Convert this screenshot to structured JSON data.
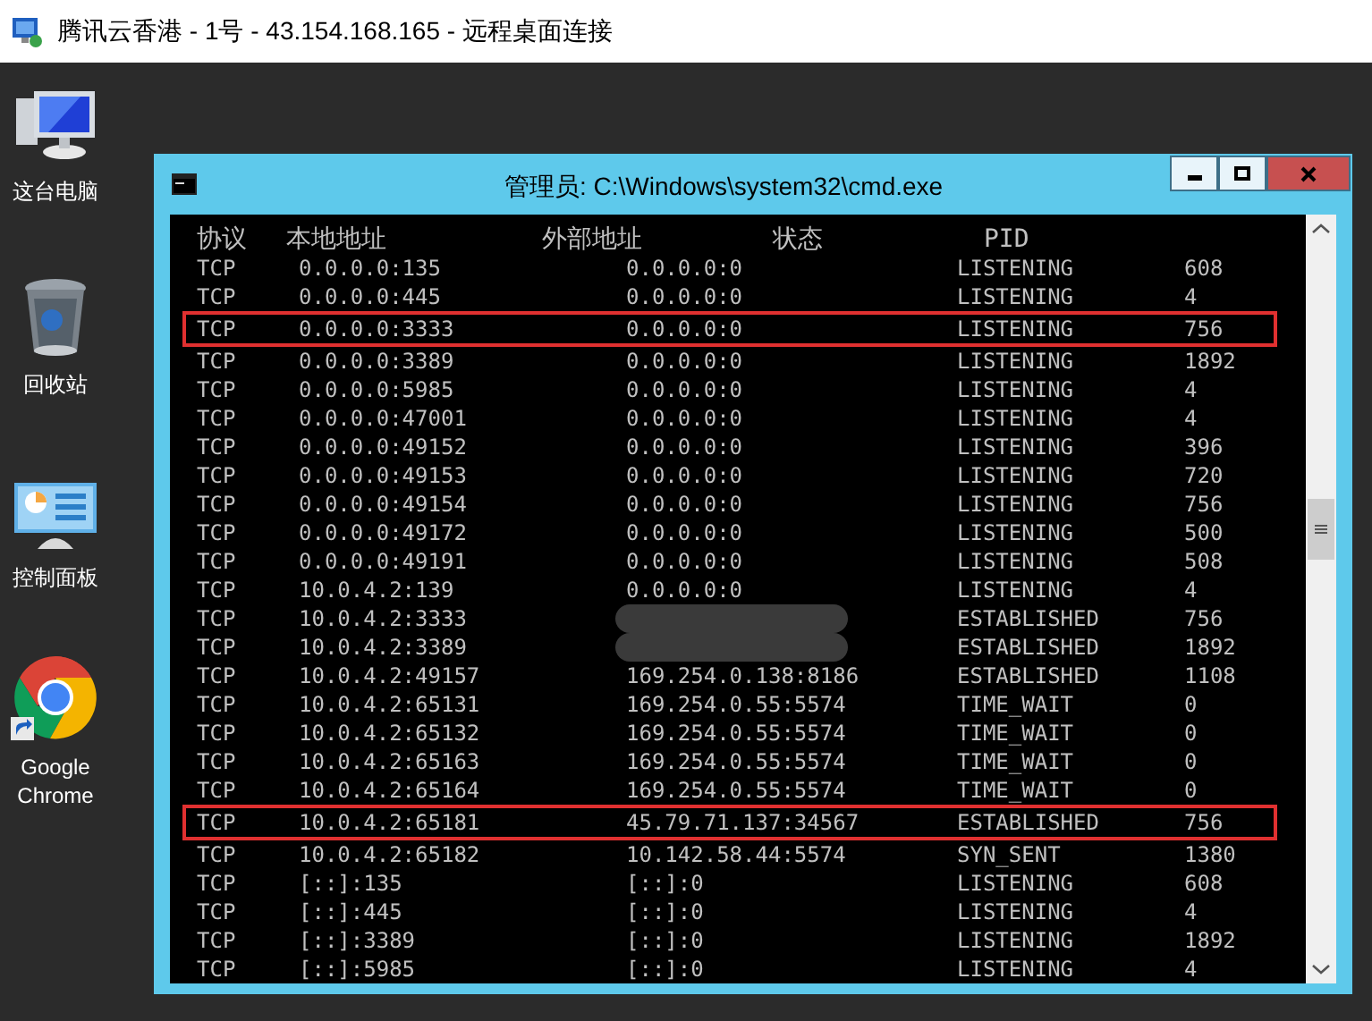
{
  "window": {
    "title": "腾讯云香港 - 1号 - 43.154.168.165 - 远程桌面连接"
  },
  "desktop_icons": [
    {
      "kind": "computer",
      "label": "这台电脑"
    },
    {
      "kind": "recycle",
      "label": "回收站"
    },
    {
      "kind": "control",
      "label": "控制面板"
    },
    {
      "kind": "browser",
      "label": "Google Chrome"
    }
  ],
  "console": {
    "title": "管理员: C:\\Windows\\system32\\cmd.exe",
    "headers": [
      "协议",
      "本地地址",
      "外部地址",
      "状态",
      "PID"
    ],
    "rows": [
      {
        "proto": "TCP",
        "local": "0.0.0.0:135",
        "foreign": "0.0.0.0:0",
        "state": "LISTENING",
        "pid": "608",
        "highlighted": false,
        "blurred": false
      },
      {
        "proto": "TCP",
        "local": "0.0.0.0:445",
        "foreign": "0.0.0.0:0",
        "state": "LISTENING",
        "pid": "4",
        "highlighted": false,
        "blurred": false
      },
      {
        "proto": "TCP",
        "local": "0.0.0.0:3333",
        "foreign": "0.0.0.0:0",
        "state": "LISTENING",
        "pid": "756",
        "highlighted": true,
        "blurred": false
      },
      {
        "proto": "TCP",
        "local": "0.0.0.0:3389",
        "foreign": "0.0.0.0:0",
        "state": "LISTENING",
        "pid": "1892",
        "highlighted": false,
        "blurred": false
      },
      {
        "proto": "TCP",
        "local": "0.0.0.0:5985",
        "foreign": "0.0.0.0:0",
        "state": "LISTENING",
        "pid": "4",
        "highlighted": false,
        "blurred": false
      },
      {
        "proto": "TCP",
        "local": "0.0.0.0:47001",
        "foreign": "0.0.0.0:0",
        "state": "LISTENING",
        "pid": "4",
        "highlighted": false,
        "blurred": false
      },
      {
        "proto": "TCP",
        "local": "0.0.0.0:49152",
        "foreign": "0.0.0.0:0",
        "state": "LISTENING",
        "pid": "396",
        "highlighted": false,
        "blurred": false
      },
      {
        "proto": "TCP",
        "local": "0.0.0.0:49153",
        "foreign": "0.0.0.0:0",
        "state": "LISTENING",
        "pid": "720",
        "highlighted": false,
        "blurred": false
      },
      {
        "proto": "TCP",
        "local": "0.0.0.0:49154",
        "foreign": "0.0.0.0:0",
        "state": "LISTENING",
        "pid": "756",
        "highlighted": false,
        "blurred": false
      },
      {
        "proto": "TCP",
        "local": "0.0.0.0:49172",
        "foreign": "0.0.0.0:0",
        "state": "LISTENING",
        "pid": "500",
        "highlighted": false,
        "blurred": false
      },
      {
        "proto": "TCP",
        "local": "0.0.0.0:49191",
        "foreign": "0.0.0.0:0",
        "state": "LISTENING",
        "pid": "508",
        "highlighted": false,
        "blurred": false
      },
      {
        "proto": "TCP",
        "local": "10.0.4.2:139",
        "foreign": "0.0.0.0:0",
        "state": "LISTENING",
        "pid": "4",
        "highlighted": false,
        "blurred": false
      },
      {
        "proto": "TCP",
        "local": "10.0.4.2:3333",
        "state": "ESTABLISHED",
        "pid": "756",
        "highlighted": false,
        "blurred": true
      },
      {
        "proto": "TCP",
        "local": "10.0.4.2:3389",
        "state": "ESTABLISHED",
        "pid": "1892",
        "highlighted": false,
        "blurred": true
      },
      {
        "proto": "TCP",
        "local": "10.0.4.2:49157",
        "foreign": "169.254.0.138:8186",
        "state": "ESTABLISHED",
        "pid": "1108",
        "highlighted": false,
        "blurred": false
      },
      {
        "proto": "TCP",
        "local": "10.0.4.2:65131",
        "foreign": "169.254.0.55:5574",
        "state": "TIME_WAIT",
        "pid": "0",
        "highlighted": false,
        "blurred": false
      },
      {
        "proto": "TCP",
        "local": "10.0.4.2:65132",
        "foreign": "169.254.0.55:5574",
        "state": "TIME_WAIT",
        "pid": "0",
        "highlighted": false,
        "blurred": false
      },
      {
        "proto": "TCP",
        "local": "10.0.4.2:65163",
        "foreign": "169.254.0.55:5574",
        "state": "TIME_WAIT",
        "pid": "0",
        "highlighted": false,
        "blurred": false
      },
      {
        "proto": "TCP",
        "local": "10.0.4.2:65164",
        "foreign": "169.254.0.55:5574",
        "state": "TIME_WAIT",
        "pid": "0",
        "highlighted": false,
        "blurred": false
      },
      {
        "proto": "TCP",
        "local": "10.0.4.2:65181",
        "foreign": "45.79.71.137:34567",
        "state": "ESTABLISHED",
        "pid": "756",
        "highlighted": true,
        "blurred": false
      },
      {
        "proto": "TCP",
        "local": "10.0.4.2:65182",
        "foreign": "10.142.58.44:5574",
        "state": "SYN_SENT",
        "pid": "1380",
        "highlighted": false,
        "blurred": false
      },
      {
        "proto": "TCP",
        "local": "[::]:135",
        "foreign": "[::]:0",
        "state": "LISTENING",
        "pid": "608",
        "highlighted": false,
        "blurred": false
      },
      {
        "proto": "TCP",
        "local": "[::]:445",
        "foreign": "[::]:0",
        "state": "LISTENING",
        "pid": "4",
        "highlighted": false,
        "blurred": false
      },
      {
        "proto": "TCP",
        "local": "[::]:3389",
        "foreign": "[::]:0",
        "state": "LISTENING",
        "pid": "1892",
        "highlighted": false,
        "blurred": false
      },
      {
        "proto": "TCP",
        "local": "[::]:5985",
        "foreign": "[::]:0",
        "state": "LISTENING",
        "pid": "4",
        "highlighted": false,
        "blurred": false
      }
    ]
  }
}
